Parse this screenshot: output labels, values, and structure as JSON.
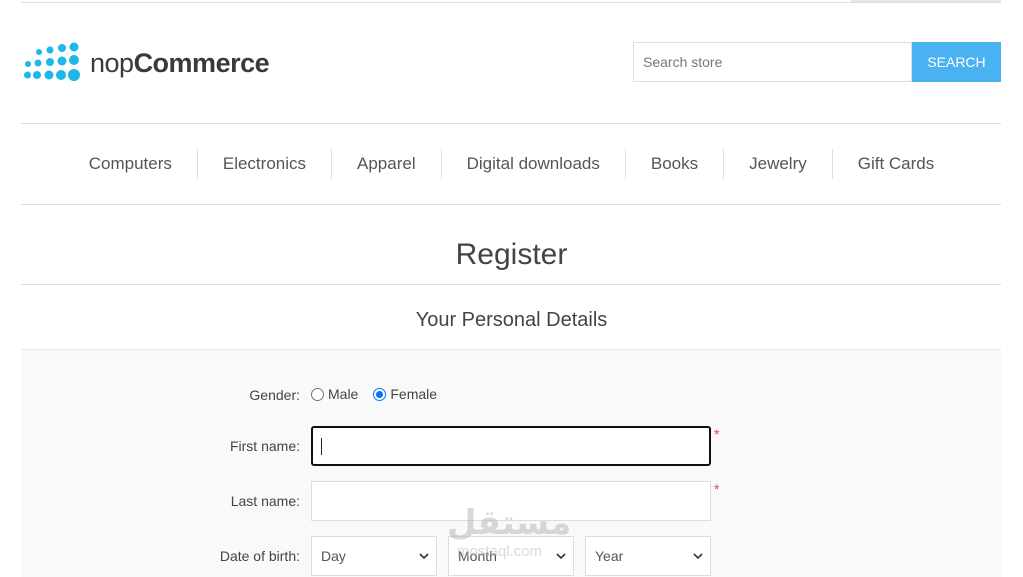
{
  "header": {
    "logo": {
      "name": "nopCommerce",
      "part1": "nop",
      "part2": "Commerce",
      "dot_color": "#1fb6e8"
    },
    "search": {
      "placeholder": "Search store",
      "value": "",
      "button_label": "SEARCH",
      "button_color": "#4ab2f1"
    }
  },
  "nav": {
    "items": [
      {
        "label": "Computers"
      },
      {
        "label": "Electronics"
      },
      {
        "label": "Apparel"
      },
      {
        "label": "Digital downloads"
      },
      {
        "label": "Books"
      },
      {
        "label": "Jewelry"
      },
      {
        "label": "Gift Cards"
      }
    ]
  },
  "page": {
    "title": "Register",
    "section_title": "Your Personal Details"
  },
  "form": {
    "gender": {
      "label": "Gender:",
      "options": [
        {
          "label": "Male",
          "checked": false
        },
        {
          "label": "Female",
          "checked": true
        }
      ]
    },
    "first_name": {
      "label": "First name:",
      "value": "",
      "required_mark": "*",
      "focused": true
    },
    "last_name": {
      "label": "Last name:",
      "value": "",
      "required_mark": "*"
    },
    "date_of_birth": {
      "label": "Date of birth:",
      "day": "Day",
      "month": "Month",
      "year": "Year"
    },
    "required_color": "#e4434b"
  },
  "watermark": {
    "arabic": "مستقل",
    "latin": "mostaql.com"
  }
}
